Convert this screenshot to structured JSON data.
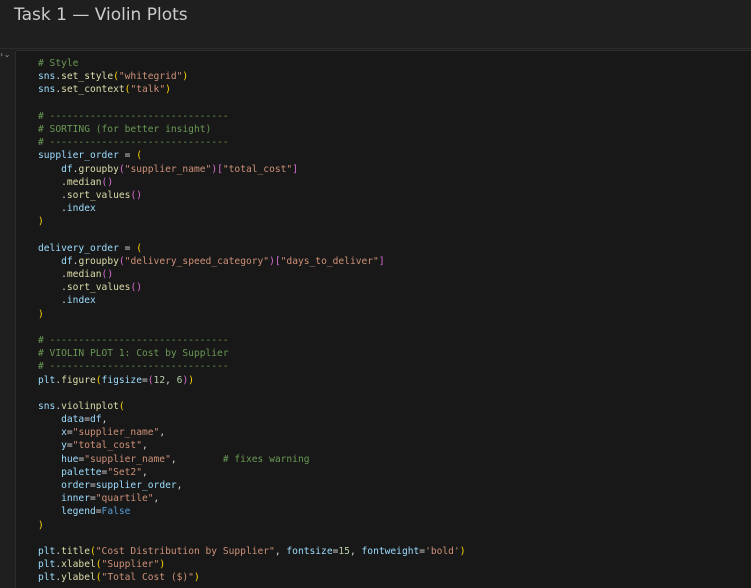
{
  "window": {
    "title": "Task 1 — Violin Plots",
    "gutter_marker": "› ⌄"
  },
  "code_lines": [
    [
      {
        "t": "# Style",
        "c": "comment"
      }
    ],
    [
      {
        "t": "sns",
        "c": "name"
      },
      {
        "t": ".",
        "c": "op"
      },
      {
        "t": "set_style",
        "c": "func"
      },
      {
        "t": "(",
        "c": "paren"
      },
      {
        "t": "\"whitegrid\"",
        "c": "str"
      },
      {
        "t": ")",
        "c": "paren"
      }
    ],
    [
      {
        "t": "sns",
        "c": "name"
      },
      {
        "t": ".",
        "c": "op"
      },
      {
        "t": "set_context",
        "c": "func"
      },
      {
        "t": "(",
        "c": "paren"
      },
      {
        "t": "\"talk\"",
        "c": "str"
      },
      {
        "t": ")",
        "c": "paren"
      }
    ],
    [],
    [
      {
        "t": "# -------------------------------",
        "c": "comment"
      }
    ],
    [
      {
        "t": "# SORTING (for better insight)",
        "c": "comment"
      }
    ],
    [
      {
        "t": "# -------------------------------",
        "c": "comment"
      }
    ],
    [
      {
        "t": "supplier_order",
        "c": "name"
      },
      {
        "t": " = ",
        "c": "op"
      },
      {
        "t": "(",
        "c": "paren"
      }
    ],
    [
      {
        "t": "    ",
        "c": "op"
      },
      {
        "t": "df",
        "c": "name"
      },
      {
        "t": ".",
        "c": "op"
      },
      {
        "t": "groupby",
        "c": "func"
      },
      {
        "t": "(",
        "c": "paren2"
      },
      {
        "t": "\"supplier_name\"",
        "c": "str"
      },
      {
        "t": ")",
        "c": "paren2"
      },
      {
        "t": "[",
        "c": "paren2"
      },
      {
        "t": "\"total_cost\"",
        "c": "str"
      },
      {
        "t": "]",
        "c": "paren2"
      }
    ],
    [
      {
        "t": "    ",
        "c": "op"
      },
      {
        "t": ".",
        "c": "op"
      },
      {
        "t": "median",
        "c": "func"
      },
      {
        "t": "()",
        "c": "paren2"
      }
    ],
    [
      {
        "t": "    ",
        "c": "op"
      },
      {
        "t": ".",
        "c": "op"
      },
      {
        "t": "sort_values",
        "c": "func"
      },
      {
        "t": "()",
        "c": "paren2"
      }
    ],
    [
      {
        "t": "    ",
        "c": "op"
      },
      {
        "t": ".",
        "c": "op"
      },
      {
        "t": "index",
        "c": "name"
      }
    ],
    [
      {
        "t": ")",
        "c": "paren"
      }
    ],
    [],
    [
      {
        "t": "delivery_order",
        "c": "name"
      },
      {
        "t": " = ",
        "c": "op"
      },
      {
        "t": "(",
        "c": "paren"
      }
    ],
    [
      {
        "t": "    ",
        "c": "op"
      },
      {
        "t": "df",
        "c": "name"
      },
      {
        "t": ".",
        "c": "op"
      },
      {
        "t": "groupby",
        "c": "func"
      },
      {
        "t": "(",
        "c": "paren2"
      },
      {
        "t": "\"delivery_speed_category\"",
        "c": "str"
      },
      {
        "t": ")",
        "c": "paren2"
      },
      {
        "t": "[",
        "c": "paren2"
      },
      {
        "t": "\"days_to_deliver\"",
        "c": "str"
      },
      {
        "t": "]",
        "c": "paren2"
      }
    ],
    [
      {
        "t": "    ",
        "c": "op"
      },
      {
        "t": ".",
        "c": "op"
      },
      {
        "t": "median",
        "c": "func"
      },
      {
        "t": "()",
        "c": "paren2"
      }
    ],
    [
      {
        "t": "    ",
        "c": "op"
      },
      {
        "t": ".",
        "c": "op"
      },
      {
        "t": "sort_values",
        "c": "func"
      },
      {
        "t": "()",
        "c": "paren2"
      }
    ],
    [
      {
        "t": "    ",
        "c": "op"
      },
      {
        "t": ".",
        "c": "op"
      },
      {
        "t": "index",
        "c": "name"
      }
    ],
    [
      {
        "t": ")",
        "c": "paren"
      }
    ],
    [],
    [
      {
        "t": "# -------------------------------",
        "c": "comment"
      }
    ],
    [
      {
        "t": "# VIOLIN PLOT 1: Cost by Supplier",
        "c": "comment"
      }
    ],
    [
      {
        "t": "# -------------------------------",
        "c": "comment"
      }
    ],
    [
      {
        "t": "plt",
        "c": "name"
      },
      {
        "t": ".",
        "c": "op"
      },
      {
        "t": "figure",
        "c": "func"
      },
      {
        "t": "(",
        "c": "paren"
      },
      {
        "t": "figsize",
        "c": "name"
      },
      {
        "t": "=",
        "c": "op"
      },
      {
        "t": "(",
        "c": "paren2"
      },
      {
        "t": "12",
        "c": "num"
      },
      {
        "t": ", ",
        "c": "op"
      },
      {
        "t": "6",
        "c": "num"
      },
      {
        "t": ")",
        "c": "paren2"
      },
      {
        "t": ")",
        "c": "paren"
      }
    ],
    [],
    [
      {
        "t": "sns",
        "c": "name"
      },
      {
        "t": ".",
        "c": "op"
      },
      {
        "t": "violinplot",
        "c": "func"
      },
      {
        "t": "(",
        "c": "paren"
      }
    ],
    [
      {
        "t": "    ",
        "c": "op"
      },
      {
        "t": "data",
        "c": "name"
      },
      {
        "t": "=",
        "c": "op"
      },
      {
        "t": "df",
        "c": "name"
      },
      {
        "t": ",",
        "c": "op"
      }
    ],
    [
      {
        "t": "    ",
        "c": "op"
      },
      {
        "t": "x",
        "c": "name"
      },
      {
        "t": "=",
        "c": "op"
      },
      {
        "t": "\"supplier_name\"",
        "c": "str"
      },
      {
        "t": ",",
        "c": "op"
      }
    ],
    [
      {
        "t": "    ",
        "c": "op"
      },
      {
        "t": "y",
        "c": "name"
      },
      {
        "t": "=",
        "c": "op"
      },
      {
        "t": "\"total_cost\"",
        "c": "str"
      },
      {
        "t": ",",
        "c": "op"
      }
    ],
    [
      {
        "t": "    ",
        "c": "op"
      },
      {
        "t": "hue",
        "c": "name"
      },
      {
        "t": "=",
        "c": "op"
      },
      {
        "t": "\"supplier_name\"",
        "c": "str"
      },
      {
        "t": ",",
        "c": "op"
      },
      {
        "t": "        ",
        "c": "op"
      },
      {
        "t": "# fixes warning",
        "c": "comment"
      }
    ],
    [
      {
        "t": "    ",
        "c": "op"
      },
      {
        "t": "palette",
        "c": "name"
      },
      {
        "t": "=",
        "c": "op"
      },
      {
        "t": "\"Set2\"",
        "c": "str"
      },
      {
        "t": ",",
        "c": "op"
      }
    ],
    [
      {
        "t": "    ",
        "c": "op"
      },
      {
        "t": "order",
        "c": "name"
      },
      {
        "t": "=",
        "c": "op"
      },
      {
        "t": "supplier_order",
        "c": "name"
      },
      {
        "t": ",",
        "c": "op"
      }
    ],
    [
      {
        "t": "    ",
        "c": "op"
      },
      {
        "t": "inner",
        "c": "name"
      },
      {
        "t": "=",
        "c": "op"
      },
      {
        "t": "\"quartile\"",
        "c": "str"
      },
      {
        "t": ",",
        "c": "op"
      }
    ],
    [
      {
        "t": "    ",
        "c": "op"
      },
      {
        "t": "legend",
        "c": "name"
      },
      {
        "t": "=",
        "c": "op"
      },
      {
        "t": "False",
        "c": "kw"
      }
    ],
    [
      {
        "t": ")",
        "c": "paren"
      }
    ],
    [],
    [
      {
        "t": "plt",
        "c": "name"
      },
      {
        "t": ".",
        "c": "op"
      },
      {
        "t": "title",
        "c": "func"
      },
      {
        "t": "(",
        "c": "paren"
      },
      {
        "t": "\"Cost Distribution by Supplier\"",
        "c": "str"
      },
      {
        "t": ", ",
        "c": "op"
      },
      {
        "t": "fontsize",
        "c": "name"
      },
      {
        "t": "=",
        "c": "op"
      },
      {
        "t": "15",
        "c": "num"
      },
      {
        "t": ", ",
        "c": "op"
      },
      {
        "t": "fontweight",
        "c": "name"
      },
      {
        "t": "=",
        "c": "op"
      },
      {
        "t": "'bold'",
        "c": "str"
      },
      {
        "t": ")",
        "c": "paren"
      }
    ],
    [
      {
        "t": "plt",
        "c": "name"
      },
      {
        "t": ".",
        "c": "op"
      },
      {
        "t": "xlabel",
        "c": "func"
      },
      {
        "t": "(",
        "c": "paren"
      },
      {
        "t": "\"Supplier\"",
        "c": "str"
      },
      {
        "t": ")",
        "c": "paren"
      }
    ],
    [
      {
        "t": "plt",
        "c": "name"
      },
      {
        "t": ".",
        "c": "op"
      },
      {
        "t": "ylabel",
        "c": "func"
      },
      {
        "t": "(",
        "c": "paren"
      },
      {
        "t": "\"Total Cost ($)\"",
        "c": "str"
      },
      {
        "t": ")",
        "c": "paren"
      }
    ]
  ]
}
